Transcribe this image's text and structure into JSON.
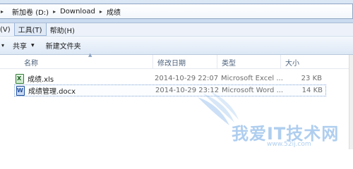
{
  "breadcrumb": {
    "items": [
      "新加卷 (D:)",
      "Download",
      "成绩"
    ]
  },
  "menubar": {
    "items": [
      {
        "label": "(V)"
      },
      {
        "label": "工具(T)"
      },
      {
        "label": "帮助(H)"
      }
    ]
  },
  "toolbar": {
    "share_label": "共享",
    "new_folder_label": "新建文件夹"
  },
  "columns": {
    "name": "名称",
    "date": "修改日期",
    "type": "类型",
    "size": "大小"
  },
  "files": [
    {
      "name": "成绩.xls",
      "date": "2014-10-29 22:07",
      "type": "Microsoft Excel ...",
      "size": "23 KB",
      "icon": "excel-file-icon"
    },
    {
      "name": "成绩管理.docx",
      "date": "2014-10-29 23:12",
      "type": "Microsoft Word ...",
      "size": "14 KB",
      "icon": "word-file-icon"
    }
  ],
  "watermark": {
    "text": "我爱IT技术网",
    "url": "www.52ij.com"
  }
}
